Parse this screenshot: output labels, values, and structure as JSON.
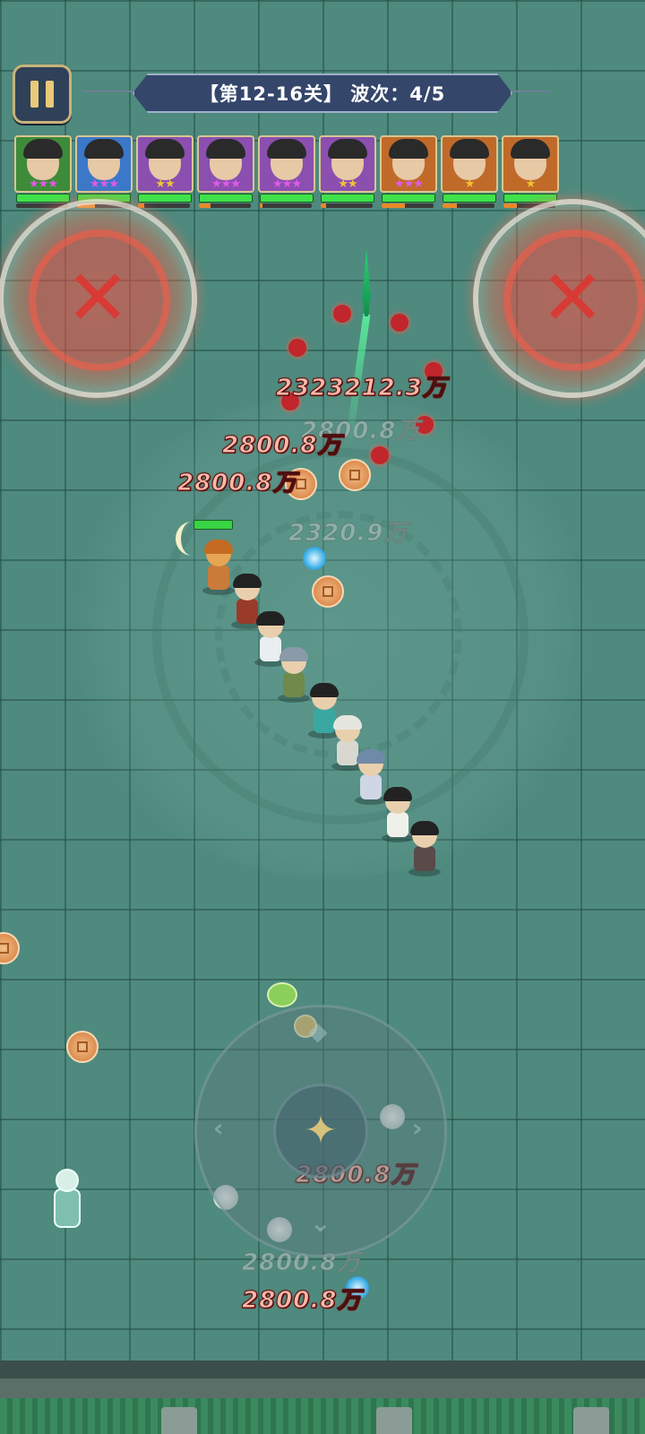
{
  "hud": {
    "pause_icon": "pause-icon",
    "level_label": "【第12-16关】 波次：4/5"
  },
  "heroes": [
    {
      "name": "tiger-hat-hero",
      "stars": "★★★",
      "star_color": "#e05ae6",
      "frame_color": "#3e8b3a",
      "hp": 1.0,
      "mp": 0.0
    },
    {
      "name": "bearded-warrior",
      "stars": "★★★",
      "star_color": "#e05ae6",
      "frame_color": "#3b78c9",
      "hp": 1.0,
      "mp": 0.35
    },
    {
      "name": "young-swordsman",
      "stars": "★★",
      "star_color": "#f2c233",
      "frame_color": "#8b4fb0",
      "hp": 1.0,
      "mp": 0.12
    },
    {
      "name": "grey-elder",
      "stars": "★★★",
      "star_color": "#e05ae6",
      "frame_color": "#8b4fb0",
      "hp": 1.0,
      "mp": 0.22
    },
    {
      "name": "long-hair-scholar",
      "stars": "★★★",
      "star_color": "#e05ae6",
      "frame_color": "#8b4fb0",
      "hp": 1.0,
      "mp": 0.06
    },
    {
      "name": "white-beard-master",
      "stars": "★★",
      "star_color": "#f2c233",
      "frame_color": "#8b4fb0",
      "hp": 1.0,
      "mp": 0.1
    },
    {
      "name": "capped-elder",
      "stars": "★★★",
      "star_color": "#e05ae6",
      "frame_color": "#c06a2a",
      "hp": 1.0,
      "mp": 0.45
    },
    {
      "name": "lady-swordswoman",
      "stars": "★",
      "star_color": "#f2c233",
      "frame_color": "#c06a2a",
      "hp": 1.0,
      "mp": 0.28
    },
    {
      "name": "young-warrior",
      "stars": "★",
      "star_color": "#f2c233",
      "frame_color": "#c06a2a",
      "hp": 1.0,
      "mp": 0.25
    }
  ],
  "damage_numbers": [
    {
      "text": "2323212.3万",
      "style": "red"
    },
    {
      "text": "2800.8万",
      "style": "faded"
    },
    {
      "text": "2800.8万",
      "style": "red"
    },
    {
      "text": "2800.8万",
      "style": "red"
    },
    {
      "text": "2320.9万",
      "style": "faded"
    },
    {
      "text": "2800.8万",
      "style": "red"
    },
    {
      "text": "2800.8万",
      "style": "faded"
    },
    {
      "text": "2800.8万",
      "style": "red"
    }
  ],
  "danger_zone_icon": "x-mark-icon",
  "joystick": {
    "center_icon": "four-point-star-icon",
    "arrows": [
      "◆",
      "‹",
      "›",
      "⌄"
    ]
  },
  "colors": {
    "hp": "#3fe24a",
    "mp": "#e88a2a",
    "danger": "#d83b35",
    "banner": "#35466b"
  }
}
